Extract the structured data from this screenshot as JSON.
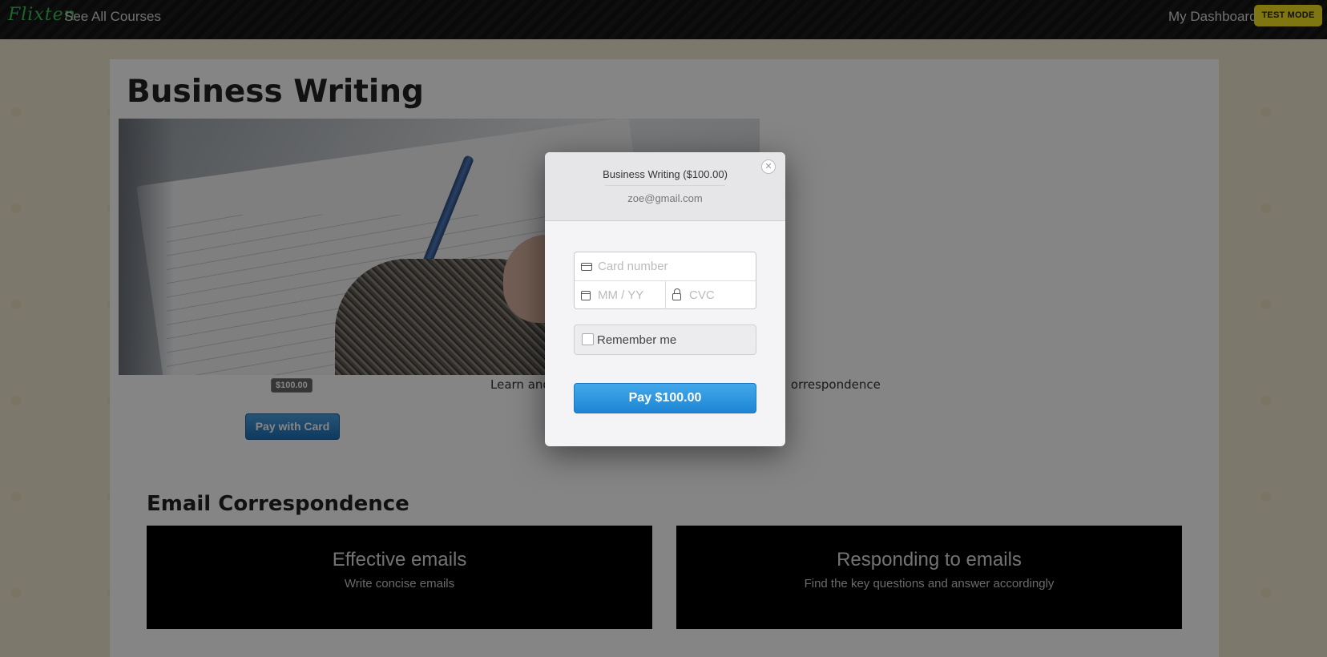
{
  "nav": {
    "logo": "Flixten",
    "see_all_courses": "See All Courses",
    "my_dashboard": "My Dashboard",
    "test_mode": "TEST MODE"
  },
  "course": {
    "title": "Business Writing",
    "price": "$100.00",
    "pay_with_card": "Pay with Card",
    "description_left": "Learn and",
    "description_right": "orrespondence"
  },
  "section": {
    "title": "Email Correspondence",
    "lessons": [
      {
        "title": "Effective emails",
        "subtitle": "Write concise emails"
      },
      {
        "title": "Responding to emails",
        "subtitle": "Find the key questions and answer accordingly"
      }
    ]
  },
  "checkout": {
    "title": "Business Writing ($100.00)",
    "email": "zoe@gmail.com",
    "card_number_placeholder": "Card number",
    "expiry_placeholder": "MM / YY",
    "cvc_placeholder": "CVC",
    "remember_me": "Remember me",
    "pay_button": "Pay $100.00",
    "close_symbol": "✕"
  },
  "colors": {
    "accent_blue": "#1d85d5",
    "test_badge": "#f5e322",
    "logo_green": "#3fbf56"
  }
}
